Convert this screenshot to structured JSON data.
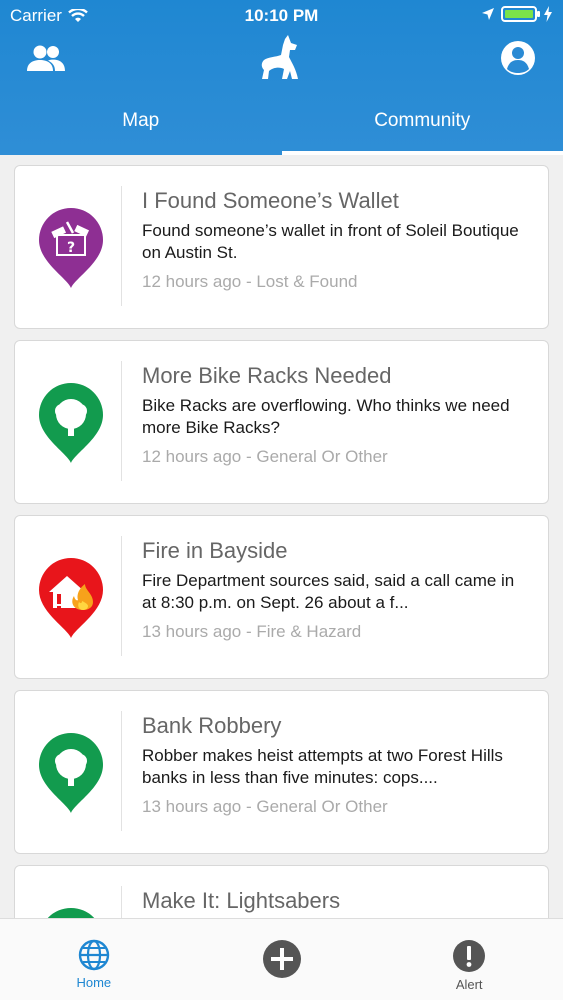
{
  "status": {
    "carrier": "Carrier",
    "time": "10:10 PM"
  },
  "tabs": [
    {
      "label": "Map",
      "active": false
    },
    {
      "label": "Community",
      "active": true
    }
  ],
  "posts": [
    {
      "title": "I Found Someone’s Wallet",
      "desc": "Found someone’s wallet in front of Soleil Boutique on Austin St.",
      "meta": "12 hours ago - Lost & Found",
      "icon": "lost-found-icon",
      "color": "#8e2f93"
    },
    {
      "title": "More Bike Racks Needed",
      "desc": "Bike Racks are overflowing. Who thinks we need more Bike Racks?",
      "meta": "12 hours ago - General Or Other",
      "icon": "tree-icon",
      "color": "#129b4e"
    },
    {
      "title": "Fire in Bayside",
      "desc": "Fire Department sources said, said a call came in at 8:30 p.m. on Sept. 26 about a f...",
      "meta": "13 hours ago - Fire & Hazard",
      "icon": "fire-house-icon",
      "color": "#e8151b"
    },
    {
      "title": "Bank Robbery",
      "desc": "Robber makes heist attempts at two Forest Hills banks in less than five minutes: cops....",
      "meta": "13 hours ago - General Or Other",
      "icon": "tree-icon",
      "color": "#129b4e"
    },
    {
      "title": "Make It: Lightsabers",
      "desc": "",
      "meta": "",
      "icon": "tree-icon",
      "color": "#129b4e"
    }
  ],
  "nav": {
    "home_label": "Home",
    "alert_label": "Alert"
  },
  "colors": {
    "header": "#1f87d2",
    "accent": "#1f87d2"
  }
}
